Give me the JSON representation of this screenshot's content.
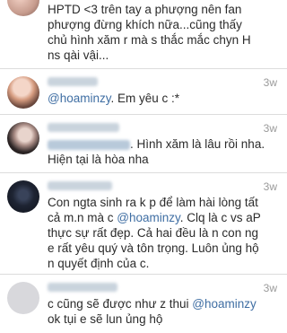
{
  "comments": [
    {
      "time": "",
      "text_lines": [
        "HPTD <3 trên tay a phượng nên fan",
        "phượng đừng khích nữa...cũng thấy",
        "chủ hình xăm r mà s thắc mắc chyn H",
        "ns qài vậi..."
      ]
    },
    {
      "time": "3w",
      "mention": "@hoaminzy",
      "rest": ". Em yêu c :*"
    },
    {
      "time": "3w",
      "rest_line1": ". Hình xăm là lâu rồi nha.",
      "line2": "Hiện tại là hòa nha"
    },
    {
      "time": "3w",
      "line1": "Con ngta sinh ra k p để làm hài lòng tất",
      "line2_pre": "cả m.n mà c ",
      "line2_mention": "@hoaminzy",
      "line2_post": ". Clq là c vs aP",
      "lines_rest": [
        "thực sự rất đẹp. Cả hai đều là n con ng",
        "e rất yêu quý và tôn trọng. Luôn ủng hộ",
        "n quyết định của c."
      ]
    },
    {
      "time": "3w",
      "line1_pre": "c cũng sẽ được như z thui ",
      "line1_mention": "@hoaminzy",
      "line2": "ok tụi e sẽ lun ủng hộ"
    }
  ],
  "colors": {
    "mention": "#3f6ea3",
    "text": "#2b2b2b",
    "time": "#9a9a9a",
    "separator": "#dcdcdc"
  }
}
